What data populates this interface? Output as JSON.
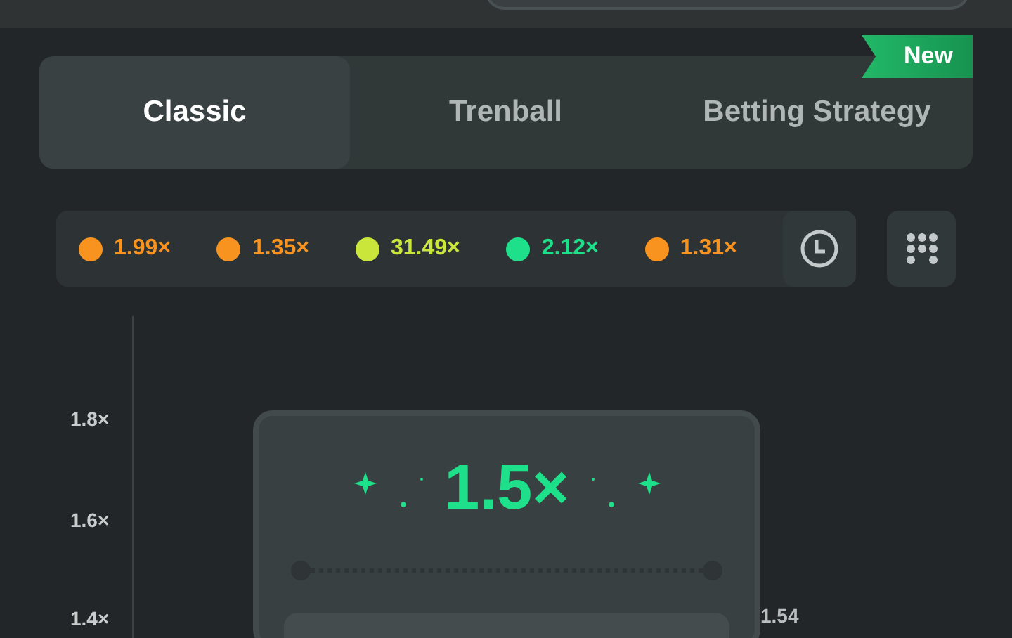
{
  "tabs": [
    {
      "label": "Classic",
      "selected": true
    },
    {
      "label": "Trenball",
      "selected": false
    },
    {
      "label": "Betting Strategy",
      "selected": false,
      "badge": "New"
    }
  ],
  "history": [
    {
      "value": "1.99×",
      "color": "#f7931e"
    },
    {
      "value": "1.35×",
      "color": "#f7931e"
    },
    {
      "value": "31.49×",
      "color": "#cbe63a"
    },
    {
      "value": "2.12×",
      "color": "#1fe08a"
    },
    {
      "value": "1.31×",
      "color": "#f7931e"
    }
  ],
  "chart": {
    "y_axis_labels": [
      "1.8×",
      "1.6×",
      "1.4×"
    ],
    "multiplier": "1.5×",
    "line_label": "1.54"
  }
}
